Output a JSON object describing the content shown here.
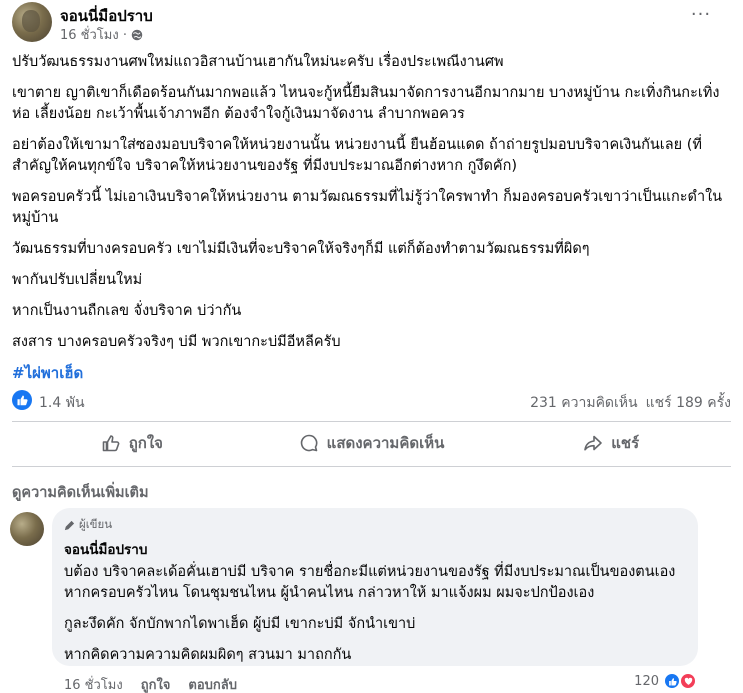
{
  "post": {
    "author": "จอนนี่มือปราบ",
    "time": "16 ชั่วโมง ·",
    "more_label": "···",
    "paragraphs": [
      "ปรับวัฒนธรรมงานศพใหม่แถวอิสานบ้านเฮากันใหม่นะครับ เรื่องประเพณีงานศพ",
      "เขาตาย ญาติเขาก็เดือดร้อนกันมากพอแล้ว ไหนจะกู้หนี้ยืมสินมาจัดการงานอีกมากมาย บางหมู่บ้าน กะเทิ่งกินกะเทิ่งห่อ เลี้ยงน้อย กะเว้าพื้นเจ้าภาพอีก ต้องจำใจกู้เงินมาจัดงาน ลำบากพอควร",
      "อย่าต้องให้เขามาใส่ซองมอบบริจาคให้หน่วยงานนั้น หน่วยงานนี้ ยืนฮ้อนแดด ถ้าถ่ายรูปมอบบริจาคเงินกันเลย (ที่สำคัญให้คนทุกข์ใจ บริจาคให้หน่วยงานของรัฐ ที่มีงบประมาณอีกต่างหาก กูงึดคัก)",
      "พอครอบครัวนี้ ไม่เอาเงินบริจาคให้หน่วยงาน ตามวัฒณธรรมที่ไม่รู้ว่าใครพาทำ  ก็มองครอบครัวเขาว่าเป็นแกะดำในหมู่บ้าน",
      "วัฒนธรรมที่บางครอบครัว เขาไม่มีเงินที่จะบริจาคให้จริงๆก็มี แต่ก็ต้องทำตามวัฒณธรรมที่ผิดๆ",
      "พากันปรับเปลี่ยนใหม่",
      "หากเป็นงานถืกเลข จั่งบริจาค บ่ว่ากัน",
      "สงสาร บางครอบครัวจริงๆ บ่มี พวกเขากะบ่มีอีหลีครับ"
    ],
    "hashtag": "#ไผ่พาเฮ็ด"
  },
  "stats": {
    "likes": "1.4 พัน",
    "comments": "231 ความคิดเห็น",
    "shares": "แชร์ 189 ครั้ง"
  },
  "actions": {
    "like": "ถูกใจ",
    "comment": "แสดงความคิดเห็น",
    "share": "แชร์"
  },
  "comments_section": {
    "more_label": "ดูความคิดเห็นเพิ่มเติม",
    "comment": {
      "badge": "ผู้เขียน",
      "author": "จอนนี่มือปราบ",
      "paragraphs": [
        "บต้อง บริจาคละเด้อคั่นเฮาบ่มี บริจาค รายชื่อกะมีแต่หน่วยงานของรัฐ ที่มีงบประมาณเป็นของตนเอง หากครอบครัวไหน โดนชุมชนไหน ผู้นำคนไหน กล่าวหาให้ มาแจ้งผม ผมจะปกป้องเอง",
        "กูละงึดคัก จักบักพากไดพาเฮ็ด ผู้บ่มี เขากะบ่มี จักนำเขาบ่",
        "หากคิดความความคิดผมผิดๆ สวนมา มาถกกัน"
      ],
      "time": "16 ชั่วโมง",
      "like": "ถูกใจ",
      "reply": "ตอบกลับ",
      "reactions": "120"
    }
  },
  "colors": {
    "accent": "#1877f2",
    "hashtag": "#216fdb",
    "secondary_text": "#65676b",
    "love": "#f33e58"
  }
}
